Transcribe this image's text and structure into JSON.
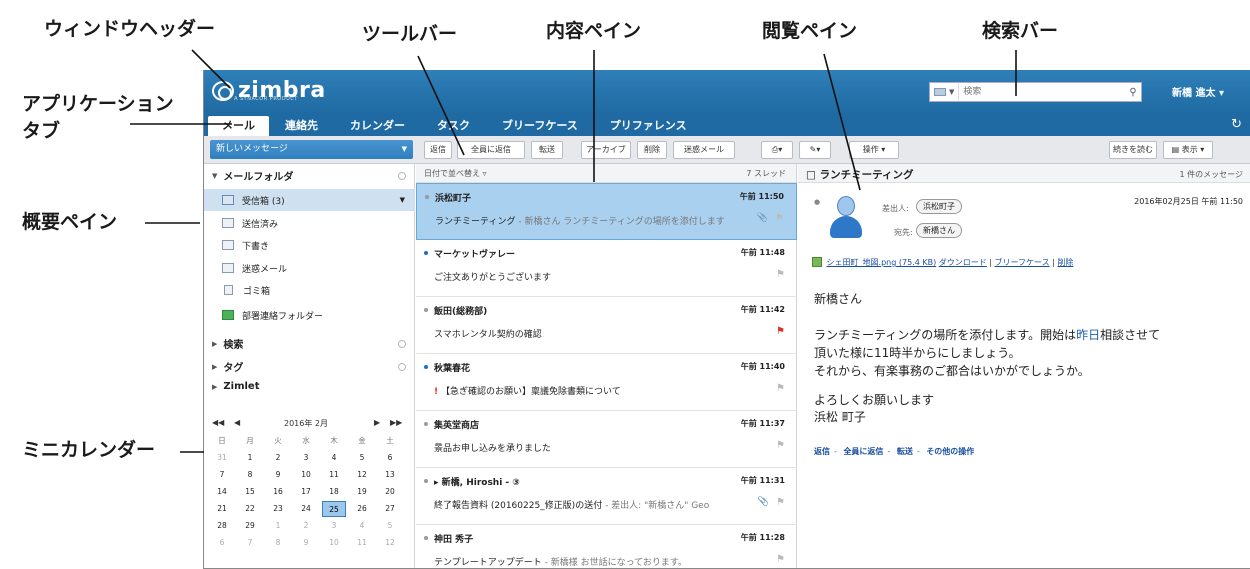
{
  "callouts": {
    "window_header": "ウィンドウヘッダー",
    "toolbar": "ツールバー",
    "content_pane": "内容ペイン",
    "reading_pane": "閲覧ペイン",
    "search_bar": "検索バー",
    "app_tabs_1": "アプリケーション",
    "app_tabs_2": "タブ",
    "overview_pane": "概要ペイン",
    "mini_calendar": "ミニカレンダー"
  },
  "header": {
    "logo": "zimbra",
    "logo_sub": "A SYNACOR PRODUCT",
    "search_placeholder": "検索",
    "user": "新橋 進太 ▾"
  },
  "tabs": [
    "メール",
    "連絡先",
    "カレンダー",
    "タスク",
    "ブリーフケース",
    "プリファレンス"
  ],
  "toolbar": {
    "new_message": "新しいメッセージ",
    "reply": "返信",
    "reply_all": "全員に返信",
    "forward": "転送",
    "archive": "アーカイブ",
    "delete": "削除",
    "spam": "迷惑メール",
    "print": "▾",
    "tag": "▾",
    "actions": "操作 ▾",
    "read_more": "続きを読む",
    "view": "表示 ▾"
  },
  "overview": {
    "mail_folders": "メールフォルダ",
    "folders": [
      {
        "name": "受信箱 (3)",
        "icon": "inbox-icon",
        "selected": true
      },
      {
        "name": "送信済み",
        "icon": "sent-icon"
      },
      {
        "name": "下書き",
        "icon": "drafts-icon"
      },
      {
        "name": "迷惑メール",
        "icon": "junk-icon"
      },
      {
        "name": "ゴミ箱",
        "icon": "trash-icon"
      },
      {
        "name": "部署連絡フォルダー",
        "icon": "folder-icon"
      }
    ],
    "search": "検索",
    "tags": "タグ",
    "zimlet": "Zimlet"
  },
  "mini_calendar": {
    "month": "2016年 2月",
    "dow": [
      "日",
      "月",
      "火",
      "水",
      "木",
      "金",
      "土"
    ],
    "weeks": [
      [
        "31",
        "1",
        "2",
        "3",
        "4",
        "5",
        "6"
      ],
      [
        "7",
        "8",
        "9",
        "10",
        "11",
        "12",
        "13"
      ],
      [
        "14",
        "15",
        "16",
        "17",
        "18",
        "19",
        "20"
      ],
      [
        "21",
        "22",
        "23",
        "24",
        "25",
        "26",
        "27"
      ],
      [
        "28",
        "29",
        "1",
        "2",
        "3",
        "4",
        "5"
      ],
      [
        "6",
        "7",
        "8",
        "9",
        "10",
        "11",
        "12"
      ]
    ],
    "today": "25"
  },
  "content": {
    "sort": "日付で並べ替え ▿",
    "thread_count": "7 スレッド",
    "messages": [
      {
        "sender": "浜松町子",
        "time": "午前 11:50",
        "subject": "ランチミーティング",
        "preview": " - 新橋さん ランチミーティングの場所を添付します",
        "unread": false,
        "attach": true,
        "flag": false,
        "selected": true
      },
      {
        "sender": "マーケットヴァレー",
        "time": "午前 11:48",
        "subject": "ご注文ありがとうございます",
        "preview": "",
        "unread": true,
        "attach": false,
        "flag": false,
        "selected": false
      },
      {
        "sender": "飯田(総務部)",
        "time": "午前 11:42",
        "subject": "スマホレンタル契約の確認",
        "preview": "",
        "unread": false,
        "attach": false,
        "flag": true,
        "selected": false
      },
      {
        "sender": "秋葉春花",
        "time": "午前 11:40",
        "subject": "【急ぎ確認のお願い】稟議免除書類について",
        "preview": "",
        "unread": true,
        "attach": false,
        "flag": false,
        "priority": "!",
        "selected": false
      },
      {
        "sender": "集英堂商店",
        "time": "午前 11:37",
        "subject": "景品お申し込みを承りました",
        "preview": "",
        "unread": false,
        "attach": false,
        "flag": false,
        "selected": false
      },
      {
        "sender": "▸ 新橋, Hiroshi - ③",
        "time": "午前 11:31",
        "subject": "終了報告資料 (20160225_修正版)の送付",
        "preview": " - 差出人: \"新橋さん\" Geo",
        "unread": false,
        "attach": true,
        "flag": false,
        "selected": false
      },
      {
        "sender": "神田 秀子",
        "time": "午前 11:28",
        "subject": "テンプレートアップデート",
        "preview": " - 新橋様 お世話になっております。",
        "unread": false,
        "attach": false,
        "flag": false,
        "selected": false
      }
    ]
  },
  "reading": {
    "title": "ランチミーティング",
    "count": "1 件のメッセージ",
    "from_label": "差出人:",
    "from": "浜松町子",
    "to_label": "宛先:",
    "to": "新橋さん",
    "date": "2016年02月25日 午前 11:50",
    "attachment": "シェ田町_地図.png (75.4 KB)",
    "att_download": "ダウンロード",
    "att_briefcase": "ブリーフケース",
    "att_delete": "削除",
    "body_greeting": "新橋さん",
    "body_1a": "ランチミーティングの場所を添付します。開始は",
    "body_1b": "昨日",
    "body_1c": "相談させて",
    "body_2": "頂いた様に11時半からにしましょう。",
    "body_3": "それから、有楽事務のご都合はいかがでしょうか。",
    "body_4": "よろしくお願いします",
    "body_5": "浜松 町子",
    "act_reply": "返信",
    "act_reply_all": "全員に返信",
    "act_forward": "転送",
    "act_more": "その他の操作"
  }
}
